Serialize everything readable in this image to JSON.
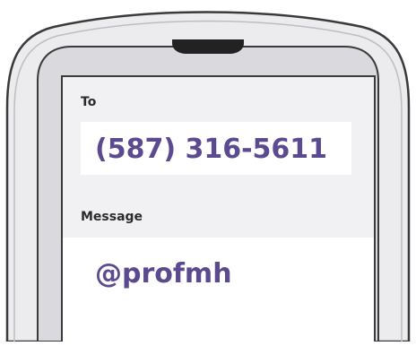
{
  "compose": {
    "to_label": "To",
    "to_value": "(587) 316-5611",
    "message_label": "Message",
    "message_value": "@profmh"
  },
  "colors": {
    "accent_text": "#5b4a8f",
    "label_text": "#2b2b2b",
    "phone_body": "#e9e9ec",
    "phone_bezel": "#dcdce0",
    "phone_outline": "#3a3a3a",
    "screen_header_bg": "#f1f1f3",
    "speaker_notch": "#222222"
  }
}
